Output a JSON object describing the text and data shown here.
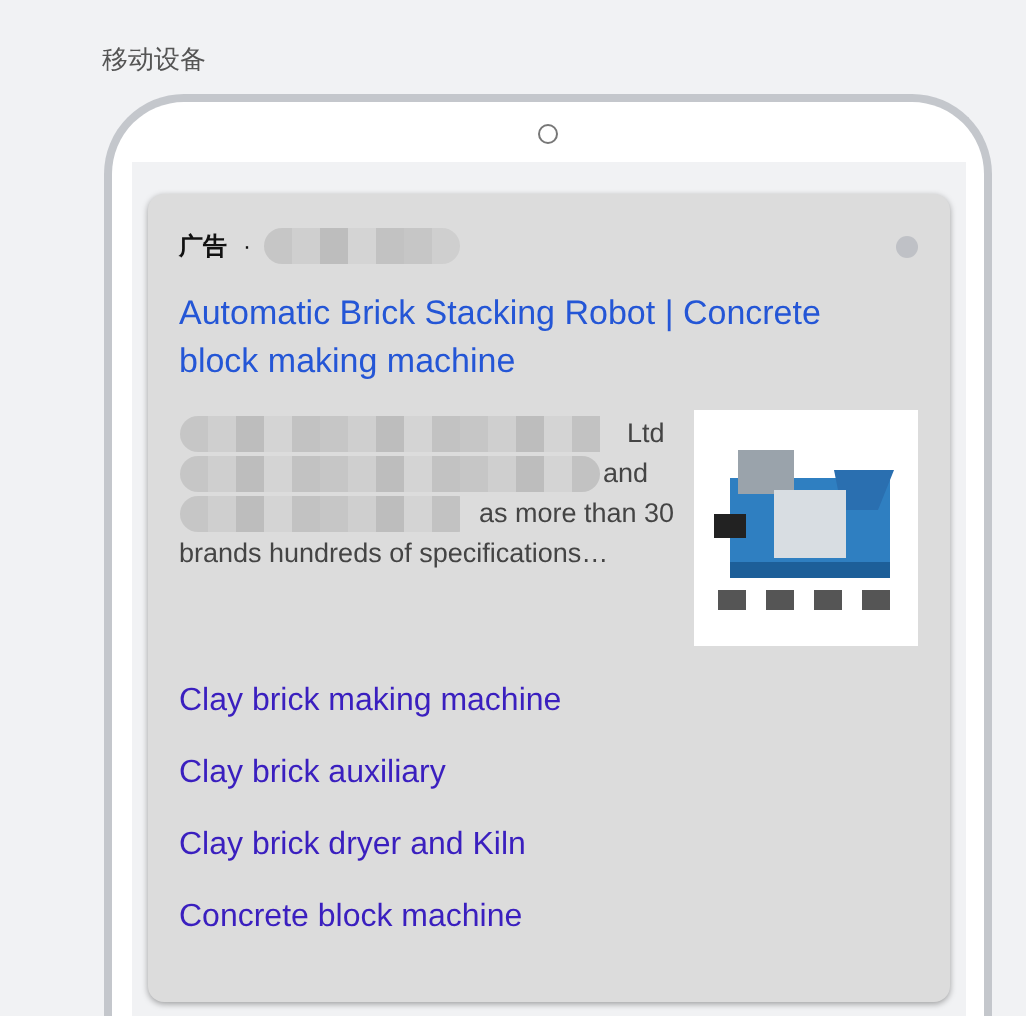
{
  "section_label": "移动设备",
  "ad": {
    "badge": "广告",
    "separator": "·",
    "title": "Automatic Brick Stacking Robot | Concrete block making machine",
    "description_lines": [
      {
        "text": "Ltd",
        "redacted": true
      },
      {
        "text": "and",
        "redacted": true
      },
      {
        "text": "as more than 30",
        "redacted": true
      },
      {
        "text": "brands hundreds of specifications…",
        "redacted": false
      }
    ],
    "sitelinks": [
      "Clay brick making machine",
      "Clay brick auxiliary",
      "Clay brick dryer and Kiln",
      "Concrete block machine"
    ]
  }
}
